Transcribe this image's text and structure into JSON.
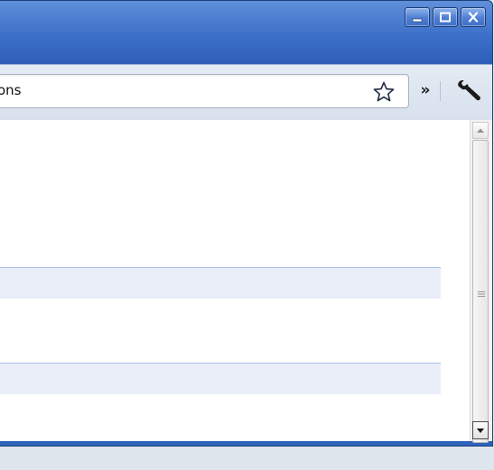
{
  "window": {
    "caption_buttons": [
      {
        "name": "minimize",
        "icon": "minimize-icon"
      },
      {
        "name": "maximize",
        "icon": "maximize-icon"
      },
      {
        "name": "close",
        "icon": "close-icon"
      }
    ]
  },
  "toolbar": {
    "address_text": "ons",
    "bookmark_icon": "star-icon",
    "overflow_label": "»",
    "menu_icon": "wrench-icon"
  },
  "content": {
    "rows": [
      {
        "style": "highlighted"
      },
      {
        "style": "highlighted"
      }
    ]
  },
  "colors": {
    "titlebar": "#3b6fc8",
    "toolbar": "#dde5f0",
    "highlight_row": "#e9eef9",
    "highlight_border": "#a9c3e8"
  }
}
